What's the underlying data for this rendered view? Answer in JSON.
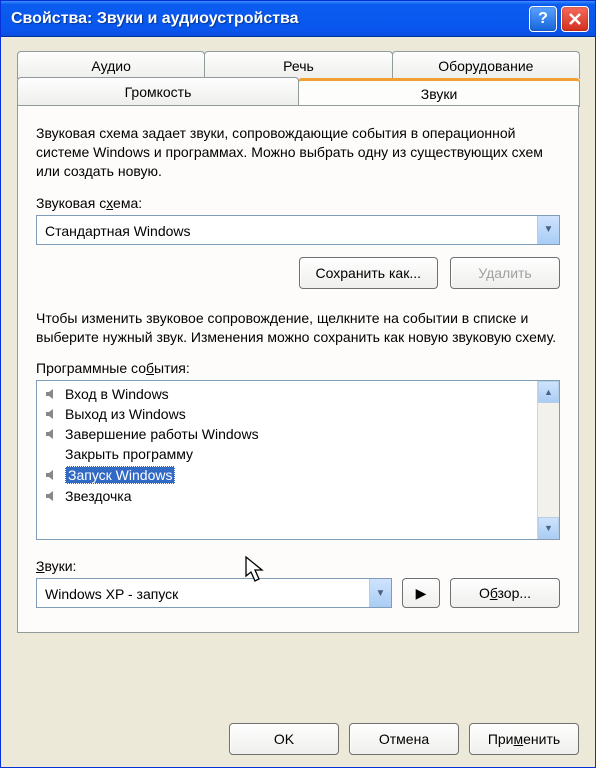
{
  "window": {
    "title": "Свойства: Звуки и аудиоустройства"
  },
  "tabs": {
    "row1": [
      "Аудио",
      "Речь",
      "Оборудование"
    ],
    "row2": [
      "Громкость",
      "Звуки"
    ],
    "active": "Звуки"
  },
  "content": {
    "scheme_desc": "Звуковая схема задает звуки, сопровождающие события в операционной системе Windows и программах. Можно выбрать одну из существующих схем или создать новую.",
    "scheme_label_pre": "Звуковая с",
    "scheme_label_ul": "х",
    "scheme_label_post": "ема:",
    "scheme_value": "Стандартная Windows",
    "save_as": "Сохранить как...",
    "delete": "Удалить",
    "events_desc": "Чтобы изменить звуковое сопровождение, щелкните на событии в списке и выберите нужный звук. Изменения можно сохранить как новую звуковую схему.",
    "events_label_pre": "Программные со",
    "events_label_ul": "б",
    "events_label_post": "ытия:",
    "events": [
      {
        "label": "Вход в Windows",
        "has_sound": true
      },
      {
        "label": "Выход из Windows",
        "has_sound": true
      },
      {
        "label": "Завершение работы Windows",
        "has_sound": true
      },
      {
        "label": "Закрыть программу",
        "has_sound": false
      },
      {
        "label": "Запуск Windows",
        "has_sound": true,
        "selected": true
      },
      {
        "label": "Звездочка",
        "has_sound": true
      }
    ],
    "sounds_label_pre": "",
    "sounds_label_ul": "З",
    "sounds_label_post": "вуки:",
    "sound_value": "Windows XP - запуск",
    "browse": "Обзор...",
    "ok": "OK",
    "cancel": "Отмена",
    "apply": "Применить"
  }
}
